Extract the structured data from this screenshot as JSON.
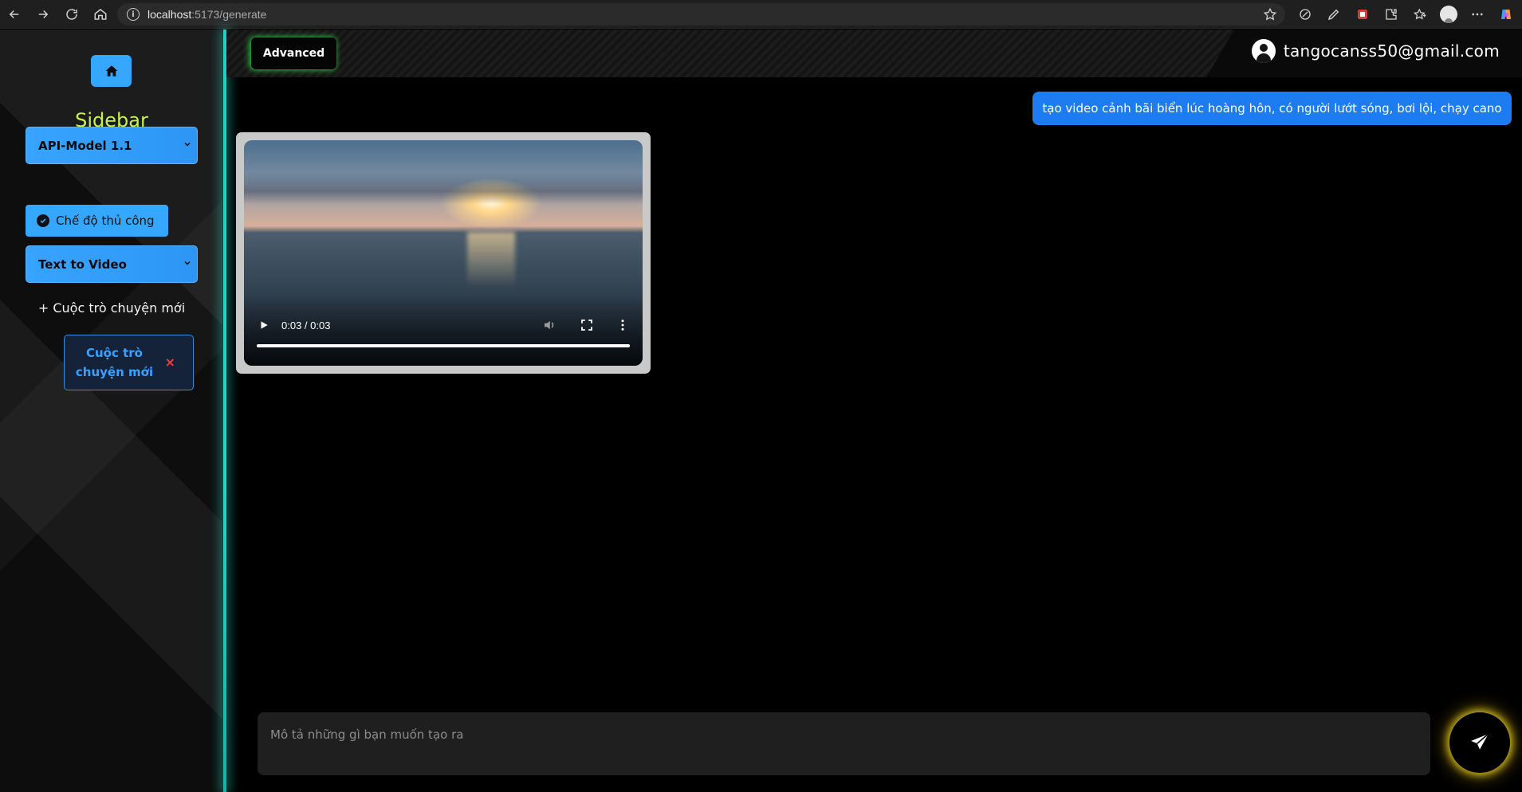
{
  "browser": {
    "url_host": "localhost",
    "url_rest": ":5173/generate"
  },
  "sidebar": {
    "title": "Sidebar",
    "model_select": "API-Model 1.1",
    "manual_mode_label": "Chế độ thủ công",
    "mode_select": "Text to Video",
    "new_chat_label": "+ Cuộc trò chuyện mới",
    "chats": [
      {
        "label": "Cuộc trò chuyện mới",
        "close": "×"
      }
    ]
  },
  "header": {
    "advanced_label": "Advanced",
    "user_email": "tangocanss50@gmail.com"
  },
  "conversation": {
    "user_message": "tạo video cảnh bãi biển lúc hoàng hôn, có người lướt sóng, bơi lội, chạy cano",
    "video": {
      "time_display": "0:03 / 0:03",
      "progress": 1.0
    }
  },
  "composer": {
    "placeholder": "Mô tả những gì bạn muốn tạo ra"
  },
  "colors": {
    "accent_blue": "#35a7ff",
    "sidebar_title": "#c8f24b",
    "divider_glow": "#1cd2c0",
    "advanced_glow": "#3cff50",
    "send_glow": "#ffe628",
    "message_bubble": "#1e7cf2"
  }
}
